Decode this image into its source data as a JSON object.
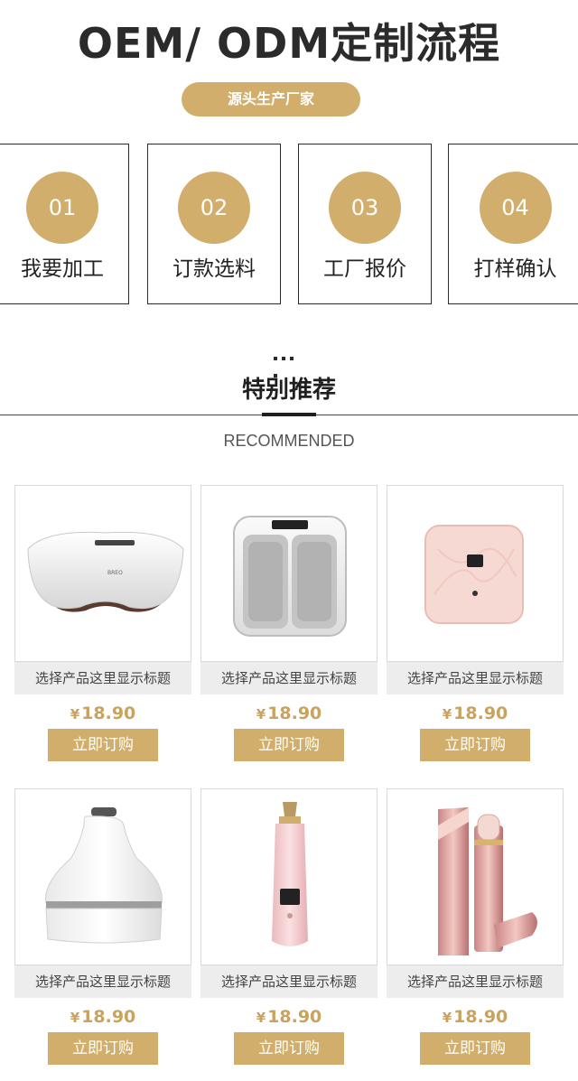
{
  "header": {
    "title": "OEM/ ODM定制流程",
    "pill": "源头生产厂家"
  },
  "steps": [
    {
      "num": "01",
      "label": "我要加工"
    },
    {
      "num": "02",
      "label": "订款选料"
    },
    {
      "num": "03",
      "label": "工厂报价"
    },
    {
      "num": "04",
      "label": "打样确认"
    }
  ],
  "section": {
    "title": "特别推荐",
    "subtitle": "RECOMMENDED"
  },
  "products": [
    {
      "caption": "选择产品这里显示标题",
      "currency": "¥",
      "price": "18.90",
      "button": "立即订购",
      "image_icon": "eye-massager-icon"
    },
    {
      "caption": "选择产品这里显示标题",
      "currency": "¥",
      "price": "18.90",
      "button": "立即订购",
      "image_icon": "foot-massager-icon"
    },
    {
      "caption": "选择产品这里显示标题",
      "currency": "¥",
      "price": "18.90",
      "button": "立即订购",
      "image_icon": "body-scale-icon"
    },
    {
      "caption": "选择产品这里显示标题",
      "currency": "¥",
      "price": "18.90",
      "button": "立即订购",
      "image_icon": "head-massager-icon"
    },
    {
      "caption": "选择产品这里显示标题",
      "currency": "¥",
      "price": "18.90",
      "button": "立即订购",
      "image_icon": "pore-cleaner-icon"
    },
    {
      "caption": "选择产品这里显示标题",
      "currency": "¥",
      "price": "18.90",
      "button": "立即订购",
      "image_icon": "hair-remover-icon"
    }
  ],
  "colors": {
    "accent": "#d2ae6d",
    "price": "#c9a35e",
    "caption_bg": "#ededed",
    "text_dark": "#2b2b2b"
  }
}
